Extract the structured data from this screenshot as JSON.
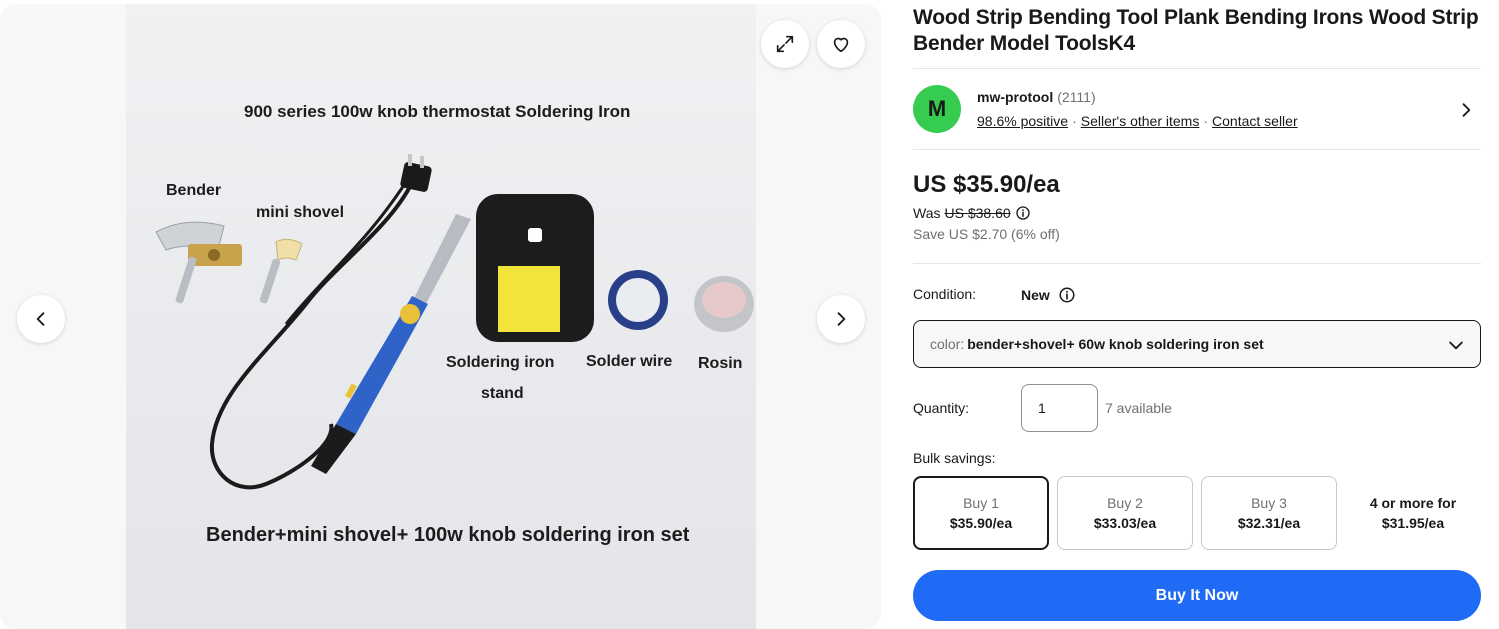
{
  "listing": {
    "title": "Wood Strip Bending Tool Plank Bending Irons Wood Strip Bender Model ToolsK4"
  },
  "gallery": {
    "photo_text": {
      "headline": "900 series 100w knob thermostat Soldering Iron",
      "bender": "Bender",
      "mini_shovel": "mini shovel",
      "stand_line1": "Soldering iron",
      "stand_line2": "stand",
      "solder_wire": "Solder wire",
      "rosin": "Rosin",
      "caption": "Bender+mini shovel+ 100w knob soldering iron set"
    },
    "icons": {
      "expand": "expand-icon",
      "favorite": "heart-icon",
      "prev": "chevron-left-icon",
      "next": "chevron-right-icon"
    }
  },
  "seller": {
    "avatar_letter": "M",
    "name": "mw-protool",
    "feedback_count": "(2111)",
    "positive": "98.6% positive",
    "other_items": "Seller's other items",
    "contact": "Contact seller",
    "avatar_color": "#36cc4f"
  },
  "pricing": {
    "price": "US $35.90/ea",
    "was_label": "Was",
    "was_price": "US $38.60",
    "save": "Save US $2.70 (6% off)"
  },
  "condition": {
    "label": "Condition:",
    "value": "New"
  },
  "variation": {
    "label": "color:",
    "value": "bender+shovel+ 60w knob soldering iron set"
  },
  "quantity": {
    "label": "Quantity:",
    "value": "1",
    "available": "7 available"
  },
  "bulk": {
    "label": "Bulk savings:",
    "tiers": [
      {
        "name": "Buy 1",
        "price": "$35.90/ea"
      },
      {
        "name": "Buy 2",
        "price": "$33.03/ea"
      },
      {
        "name": "Buy 3",
        "price": "$32.31/ea"
      },
      {
        "name": "4 or more for",
        "price": "$31.95/ea"
      }
    ]
  },
  "actions": {
    "buy_now": "Buy It Now"
  },
  "colors": {
    "accent": "#1f6bf5",
    "text": "#191919",
    "muted": "#707070"
  }
}
